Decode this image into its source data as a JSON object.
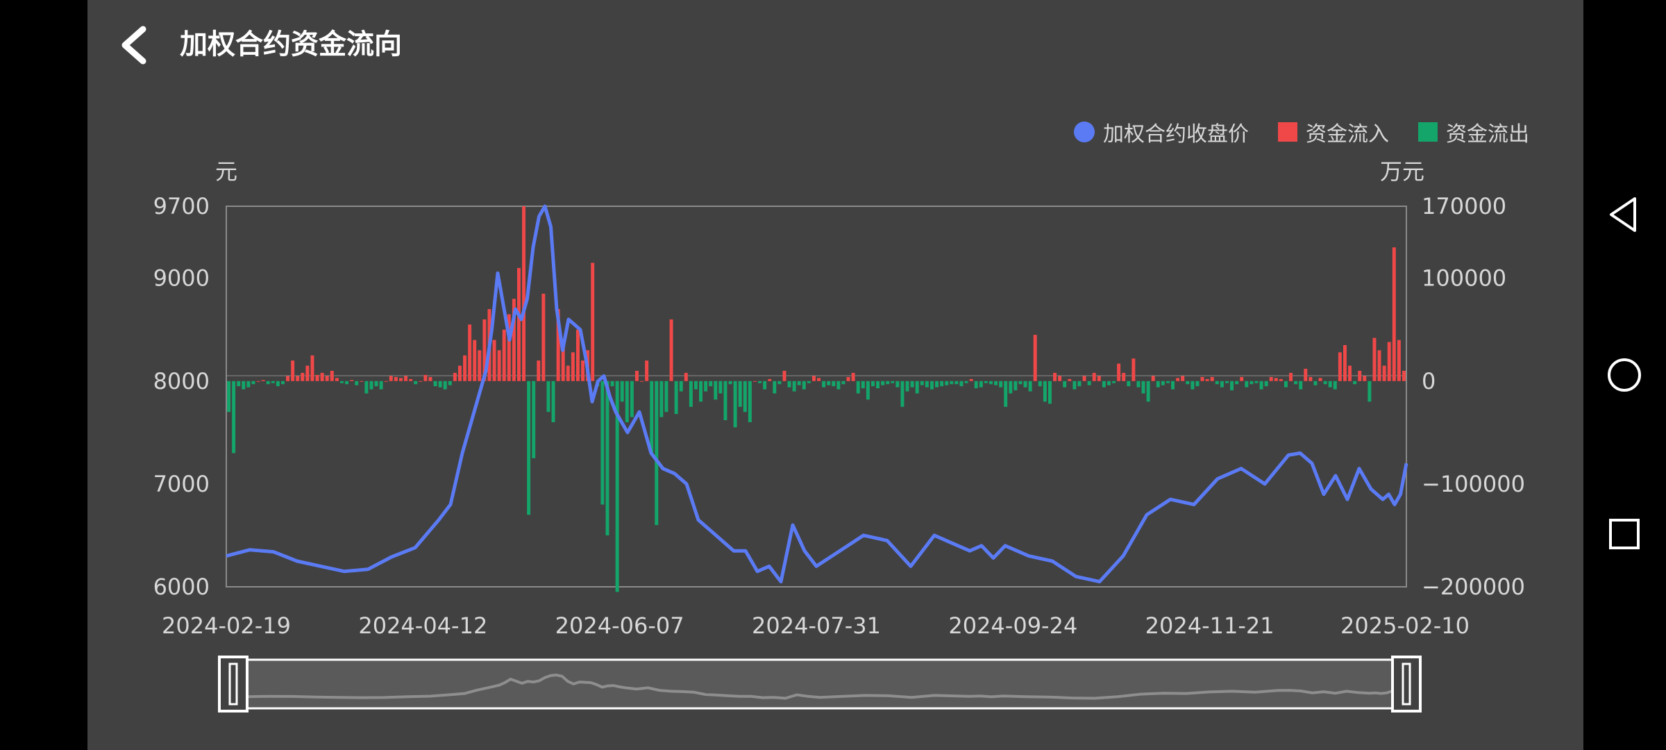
{
  "header": {
    "title": "加权合约资金流向",
    "back_icon": "chevron-left-icon"
  },
  "legend": [
    {
      "label": "加权合约收盘价",
      "color": "#5b7bf5",
      "shape": "circle"
    },
    {
      "label": "资金流入",
      "color": "#f04848",
      "shape": "square"
    },
    {
      "label": "资金流出",
      "color": "#13a56a",
      "shape": "square"
    }
  ],
  "chart_data": {
    "type": "bar+line",
    "left_axis": {
      "unit_label": "元",
      "ticks": [
        "9700",
        "9000",
        "8000",
        "7000",
        "6000"
      ]
    },
    "right_axis": {
      "unit_label": "万元",
      "ticks": [
        "170000",
        "100000",
        "0",
        "−100000",
        "−200000"
      ]
    },
    "x_axis": {
      "tick_labels": [
        "2024-02-19",
        "2024-04-12",
        "2024-06-07",
        "2024-07-31",
        "2024-09-24",
        "2024-11-21",
        "2025-02-10"
      ]
    },
    "price_ylim": [
      6000,
      9700
    ],
    "flow_ylim": [
      -200000,
      170000
    ],
    "price_series": {
      "name": "加权合约收盘价",
      "x_frac": [
        0,
        0.02,
        0.04,
        0.06,
        0.08,
        0.1,
        0.12,
        0.14,
        0.16,
        0.18,
        0.19,
        0.2,
        0.21,
        0.22,
        0.225,
        0.23,
        0.24,
        0.245,
        0.25,
        0.255,
        0.26,
        0.265,
        0.27,
        0.275,
        0.28,
        0.285,
        0.29,
        0.3,
        0.305,
        0.31,
        0.315,
        0.32,
        0.325,
        0.33,
        0.34,
        0.35,
        0.36,
        0.37,
        0.38,
        0.39,
        0.4,
        0.41,
        0.42,
        0.43,
        0.44,
        0.45,
        0.46,
        0.47,
        0.48,
        0.49,
        0.5,
        0.52,
        0.54,
        0.56,
        0.58,
        0.6,
        0.62,
        0.63,
        0.64,
        0.65,
        0.66,
        0.68,
        0.7,
        0.72,
        0.74,
        0.76,
        0.78,
        0.8,
        0.82,
        0.84,
        0.86,
        0.88,
        0.9,
        0.91,
        0.92,
        0.93,
        0.94,
        0.95,
        0.96,
        0.97,
        0.98,
        0.985,
        0.99,
        0.995,
        1.0
      ],
      "price": [
        6300,
        6360,
        6340,
        6250,
        6200,
        6150,
        6170,
        6290,
        6380,
        6650,
        6800,
        7300,
        7700,
        8100,
        8500,
        9050,
        8400,
        8700,
        8600,
        8800,
        9300,
        9600,
        9700,
        9500,
        8700,
        8300,
        8600,
        8500,
        8200,
        7800,
        8000,
        8050,
        7850,
        7700,
        7500,
        7700,
        7300,
        7150,
        7100,
        7000,
        6650,
        6550,
        6450,
        6350,
        6350,
        6150,
        6200,
        6050,
        6600,
        6350,
        6200,
        6350,
        6500,
        6450,
        6200,
        6500,
        6400,
        6350,
        6400,
        6280,
        6400,
        6300,
        6250,
        6100,
        6050,
        6300,
        6700,
        6850,
        6800,
        7050,
        7150,
        7000,
        7280,
        7300,
        7200,
        6900,
        7080,
        6850,
        7150,
        6950,
        6850,
        6900,
        6800,
        6900,
        7200
      ],
      "color": "#5b7bf5"
    },
    "flow_series": {
      "name": "资金流入/流出",
      "values": [
        -30000,
        -70000,
        -5000,
        -8000,
        -6000,
        -3000,
        0,
        1000,
        -3000,
        -2000,
        -5000,
        -3000,
        5000,
        20000,
        5000,
        8000,
        15000,
        25000,
        6000,
        8000,
        5000,
        10000,
        3000,
        -2000,
        -3000,
        1000,
        -4000,
        0,
        -12000,
        -8000,
        -5000,
        -8000,
        0,
        5000,
        4000,
        3000,
        5000,
        2000,
        -3000,
        0,
        6000,
        4000,
        -5000,
        -6000,
        -8000,
        -4000,
        8000,
        15000,
        25000,
        55000,
        40000,
        30000,
        60000,
        70000,
        40000,
        30000,
        50000,
        65000,
        80000,
        110000,
        170000,
        -130000,
        -75000,
        20000,
        85000,
        -30000,
        -40000,
        70000,
        40000,
        15000,
        28000,
        50000,
        20000,
        30000,
        115000,
        -5000,
        -120000,
        -150000,
        -5000,
        -205000,
        -20000,
        -40000,
        -35000,
        10000,
        0,
        20000,
        -70000,
        -140000,
        -35000,
        -30000,
        60000,
        -32000,
        -10000,
        8000,
        -25000,
        -8000,
        -20000,
        -10000,
        -5000,
        -18000,
        -12000,
        -38000,
        -3000,
        -45000,
        -25000,
        -30000,
        -40000,
        0,
        -2000,
        -8000,
        2000,
        -12000,
        -3000,
        10000,
        -6000,
        -10000,
        -4000,
        -8000,
        -2000,
        5000,
        3000,
        -6000,
        -4000,
        -5000,
        -8000,
        -3000,
        4000,
        8000,
        -12000,
        -7000,
        -18000,
        -5000,
        -7000,
        -4000,
        -3000,
        -2000,
        -6000,
        -25000,
        -10000,
        -6000,
        -12000,
        -4000,
        -6000,
        -8000,
        -6000,
        -5000,
        -4000,
        -3000,
        -3000,
        -5000,
        -2000,
        2000,
        -7000,
        -6000,
        -2000,
        -3000,
        -4000,
        -6000,
        -25000,
        -12000,
        -9000,
        -3000,
        -6000,
        -10000,
        45000,
        -5000,
        -20000,
        -22000,
        8000,
        5000,
        -6000,
        2000,
        -8000,
        -5000,
        5000,
        -4000,
        8000,
        5000,
        -6000,
        -4000,
        -2000,
        17000,
        8000,
        -5000,
        22000,
        -6000,
        -12000,
        -20000,
        5000,
        -6000,
        -4000,
        -2000,
        -8000,
        3000,
        5000,
        -3000,
        -8000,
        -5000,
        4000,
        2000,
        4000,
        -3000,
        -6000,
        -2000,
        -9000,
        -3000,
        4000,
        -6000,
        -3000,
        -2000,
        -8000,
        -5000,
        4000,
        3000,
        2000,
        -6000,
        8000,
        -3000,
        -8000,
        12000,
        4000,
        -4000,
        3000,
        -3000,
        -6000,
        -8000,
        28000,
        35000,
        15000,
        -3000,
        10000,
        5000,
        -20000,
        42000,
        30000,
        15000,
        38000,
        130000,
        40000,
        10000
      ],
      "pos_color": "#f04848",
      "neg_color": "#13a56a"
    }
  },
  "zoom_slider": {
    "start": 0,
    "end": 1
  },
  "system_nav": {
    "back_icon": "triangle-back-icon",
    "home_icon": "circle-home-icon",
    "recents_icon": "square-recents-icon"
  }
}
